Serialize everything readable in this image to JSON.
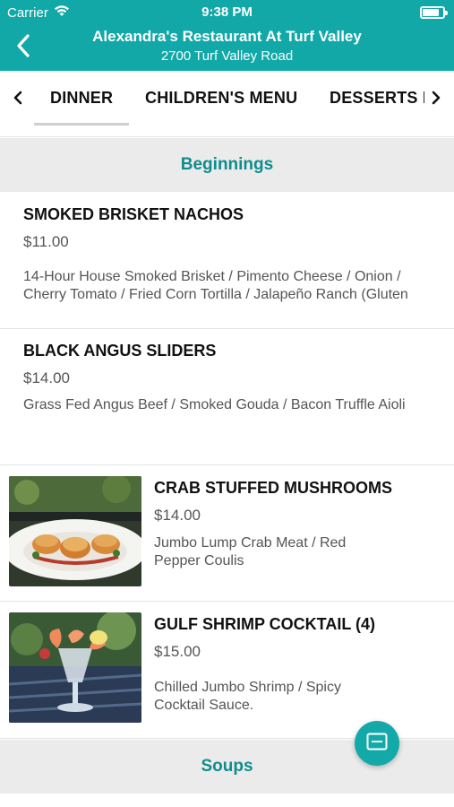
{
  "status_bar": {
    "carrier": "Carrier",
    "time": "9:38 PM",
    "icons": [
      "wifi-icon",
      "battery-icon"
    ]
  },
  "nav": {
    "title": "Alexandra's Restaurant At Turf Valley",
    "subtitle": "2700 Turf Valley Road",
    "back_icon": "chevron-left-icon"
  },
  "tabs": {
    "items": [
      {
        "label": "DINNER",
        "selected": true
      },
      {
        "label": "CHILDREN'S MENU",
        "selected": false
      },
      {
        "label": "DESSERTS I",
        "selected": false
      }
    ],
    "left_icon": "chevron-left-icon",
    "right_icon": "chevron-right-icon"
  },
  "sections": [
    {
      "title": "Beginnings"
    },
    {
      "title": "Soups"
    }
  ],
  "items": [
    {
      "name": "SMOKED BRISKET NACHOS",
      "price": "$11.00",
      "description": "14-Hour House Smoked Brisket / Pimento Cheese / Onion / Cherry Tomato / Fried Corn Tortilla / Jalapeño Ranch (Gluten",
      "has_image": false
    },
    {
      "name": "BLACK ANGUS SLIDERS",
      "price": "$14.00",
      "description": "Grass Fed Angus Beef / Smoked Gouda / Bacon Truffle Aioli",
      "has_image": false
    },
    {
      "name": "CRAB STUFFED MUSHROOMS",
      "price": "$14.00",
      "description": "Jumbo Lump Crab Meat / Red Pepper Coulis",
      "has_image": true
    },
    {
      "name": "GULF SHRIMP COCKTAIL (4)",
      "price": "$15.00",
      "description": "Chilled Jumbo Shrimp / Spicy Cocktail Sauce.",
      "has_image": true
    }
  ],
  "fab": {
    "icon": "menu-card-icon"
  },
  "colors": {
    "brand": "#12a8a8",
    "section_text": "#0f8c8c",
    "section_bg": "#ebebeb"
  }
}
